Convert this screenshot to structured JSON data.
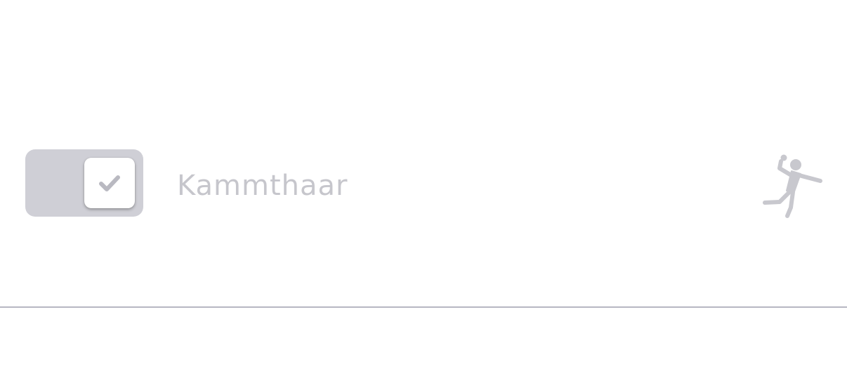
{
  "row": {
    "toggle": {
      "checked": true,
      "disabled": true
    },
    "label": "Kammthaar",
    "icon": "handball-icon"
  },
  "colors": {
    "toggle_track": "#cfcfd6",
    "check_mark": "#b9b9c1",
    "label_text": "#c6c6cc",
    "icon": "#c8c8ce",
    "divider": "#b7b7c2"
  }
}
